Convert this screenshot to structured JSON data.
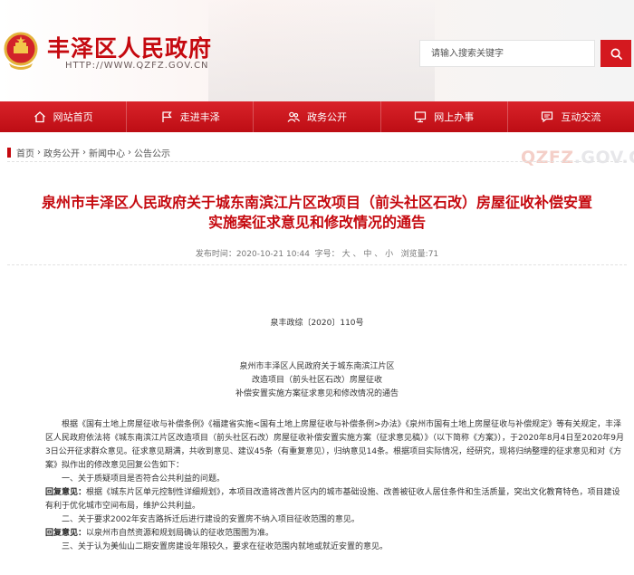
{
  "header": {
    "site_title": "丰泽区人民政府",
    "site_url": "HTTP://WWW.QZFZ.GOV.CN",
    "search_placeholder": "请输入搜索关键字"
  },
  "nav": [
    {
      "label": "网站首页",
      "icon": "home-icon"
    },
    {
      "label": "走进丰泽",
      "icon": "flag-icon"
    },
    {
      "label": "政务公开",
      "icon": "people-icon"
    },
    {
      "label": "网上办事",
      "icon": "monitor-icon"
    },
    {
      "label": "互动交流",
      "icon": "chat-icon"
    }
  ],
  "breadcrumb": [
    "首页",
    "政务公开",
    "新闻中心",
    "公告公示"
  ],
  "watermark": {
    "accent": "QZFZ",
    "rest": ".GOV.CN"
  },
  "article": {
    "title_line1": "泉州市丰泽区人民政府关于城东南滨江片区改项目（前头社区石改）房屋征收补偿安置",
    "title_line2": "实施案征求意见和修改情况的通告",
    "date": "发布时间：2020-10-21 10:44",
    "font_label": "字号：",
    "size_large": "大",
    "size_medium": "中",
    "size_small": "小",
    "views": "浏览量:71",
    "doc_no": "泉丰政综〔2020〕110号",
    "addr_lines": [
      "泉州市丰泽区人民政府关于城东南滨江片区",
      "改造项目（前头社区石改）房屋征收",
      "补偿安置实施方案征求意见和修改情况的通告"
    ],
    "para1": "根据《国有土地上房屋征收与补偿条例》《福建省实施<国有土地上房屋征收与补偿条例>办法》《泉州市国有土地上房屋征收与补偿规定》等有关规定，丰泽区人民政府依法将《城东南滨江片区改造项目（前头社区石改）房屋征收补偿安置实施方案（征求意见稿）》（以下简称《方案》），于2020年8月4日至2020年9月3日公开征求群众意见。征求意见期满，共收到意见、建议45条（有重复意见），归纳意见14条。根据项目实际情况，经研究，现将归纳整理的征求意见和对《方案》拟作出的修改意见回复公告如下：",
    "item1": "一、关于质疑项目是否符合公共利益的问题。",
    "reply_label": "回复意见：",
    "reply1": "根据《城东片区单元控制性详细规划》，本项目改造将改善片区内的城市基础设施、改善被征收人居住条件和生活质量，突出文化教育特色，项目建设有利于优化城市空间布局，维护公共利益。",
    "item2": "二、关于要求2002年安吉路拆迁后进行建设的安置房不纳入项目征收范围的意见。",
    "reply2": "以泉州市自然资源和规划局确认的征收范围图为准。",
    "item3": "三、关于认为美仙山二期安置房建设年限较久，要求在征收范围内就地或就近安置的意见。"
  },
  "colors": {
    "brand_red": "#c5090f",
    "nav_red": "#d4191f"
  }
}
